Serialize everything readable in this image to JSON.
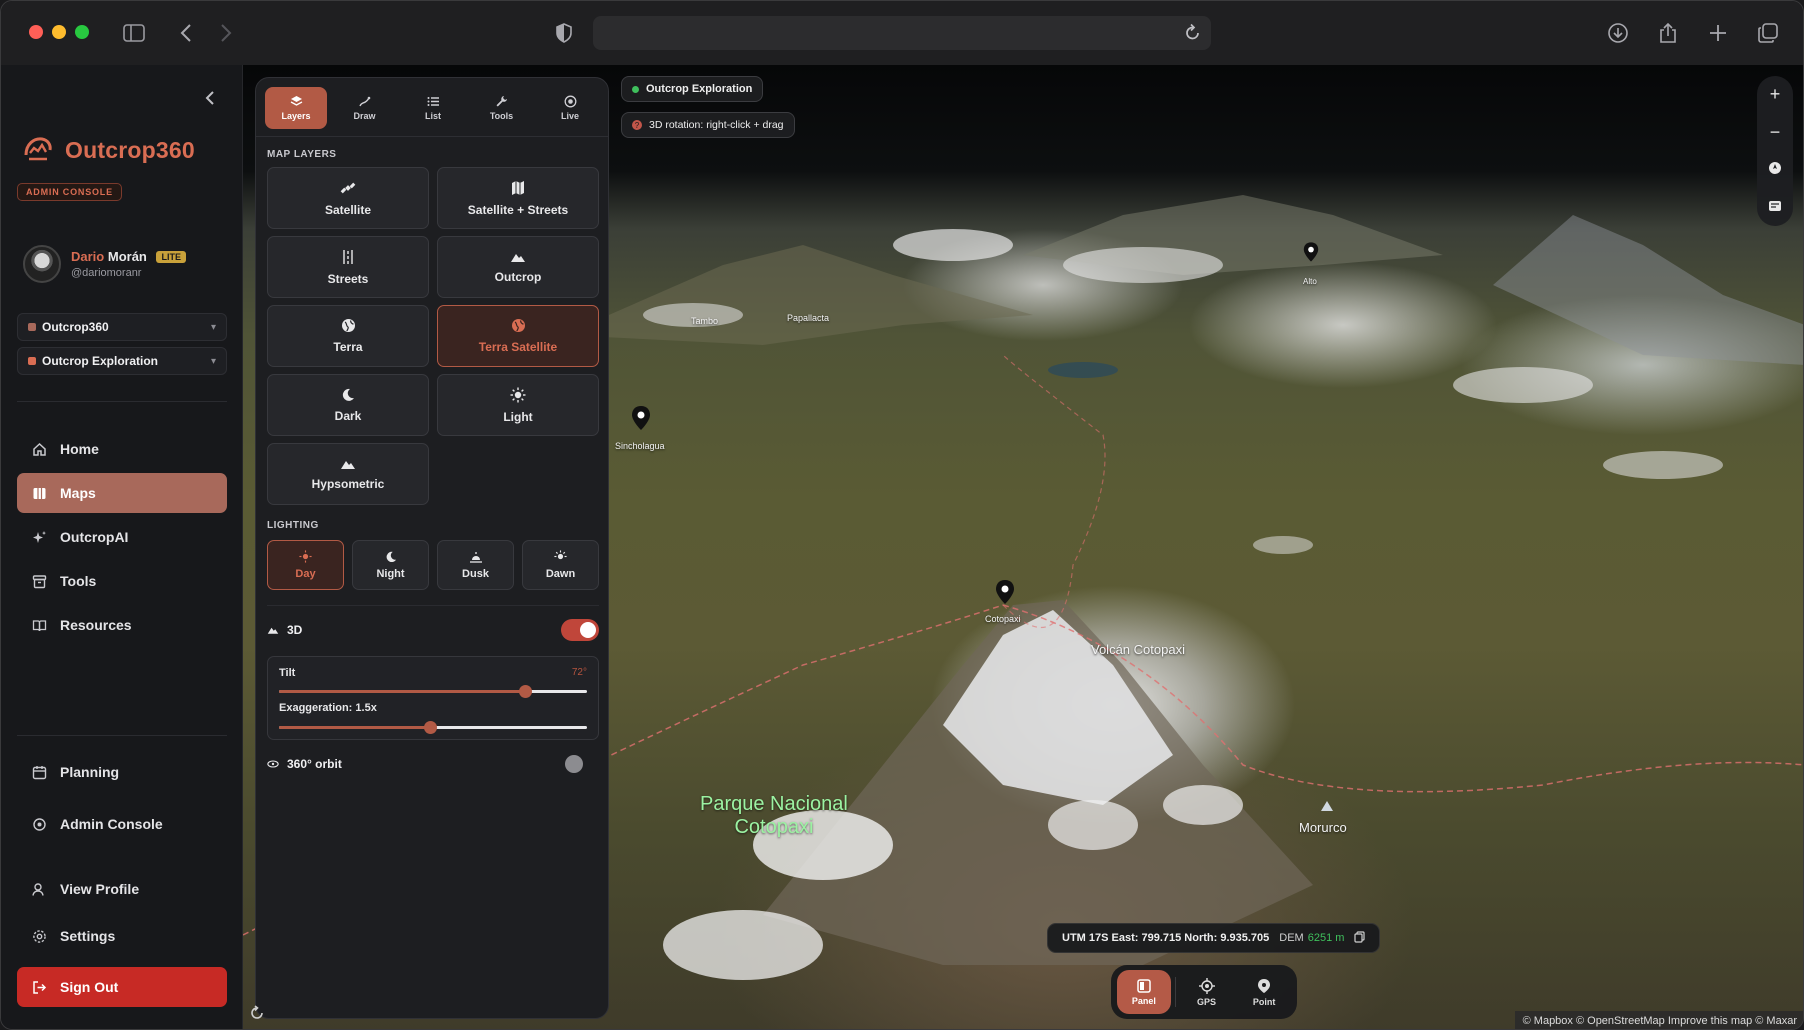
{
  "sidebar": {
    "brand": "Outcrop360",
    "admin_badge": "ADMIN CONSOLE",
    "user": {
      "first_name": "Dario",
      "last_name": "Morán",
      "plan": "LITE",
      "handle": "@dariomoranr"
    },
    "org_select": "Outcrop360",
    "project_select": "Outcrop Exploration",
    "nav": {
      "home": "Home",
      "maps": "Maps",
      "outcropai": "OutcropAI",
      "tools": "Tools",
      "resources": "Resources",
      "planning": "Planning",
      "admin_console": "Admin Console",
      "view_profile": "View Profile",
      "settings": "Settings",
      "sign_out": "Sign Out"
    }
  },
  "panel": {
    "tabs": {
      "layers": "Layers",
      "draw": "Draw",
      "list": "List",
      "tools": "Tools",
      "live": "Live"
    },
    "active_tab": "Layers",
    "map_layers_title": "MAP LAYERS",
    "layers": {
      "satellite": "Satellite",
      "satellite_streets": "Satellite + Streets",
      "streets": "Streets",
      "outcrop": "Outcrop",
      "terra": "Terra",
      "terra_satellite": "Terra Satellite",
      "dark": "Dark",
      "light": "Light",
      "hypsometric": "Hypsometric"
    },
    "active_layer": "Terra Satellite",
    "lighting_title": "LIGHTING",
    "lighting": {
      "day": "Day",
      "night": "Night",
      "dusk": "Dusk",
      "dawn": "Dawn"
    },
    "active_lighting": "Day",
    "three_d": {
      "label": "3D",
      "enabled": true
    },
    "tilt": {
      "label": "Tilt",
      "value_text": "72°",
      "fraction": 0.8
    },
    "exaggeration": {
      "label": "Exaggeration: 1.5x",
      "fraction": 0.49
    },
    "orbit": {
      "label": "360° orbit",
      "enabled": false
    }
  },
  "map": {
    "project_pill": "Outcrop Exploration",
    "hint_pill": "3D rotation: right-click + drag",
    "controls": {
      "zoom_in": "+",
      "zoom_out": "−"
    },
    "labels": {
      "volcan": "Volcán Cotopaxi",
      "park_line1": "Parque Nacional",
      "park_line2": "Cotopaxi",
      "morurco": "Morurco",
      "cotopaxi_pin": "Cotopaxi",
      "sincholagua_pin": "Sincholagua",
      "tambo": "Tambo",
      "papallacta": "Papallacta",
      "alto_pin": "Alto"
    },
    "coords": {
      "text": "UTM 17S East: 799.715 North: 9.935.705",
      "dem_label": "DEM",
      "dem_value": "6251 m"
    },
    "bottom_bar": {
      "panel": "Panel",
      "gps": "GPS",
      "point": "Point"
    },
    "attribution": "© Mapbox © OpenStreetMap  Improve this map © Maxar"
  },
  "colors": {
    "accent": "#b25a45",
    "brand": "#d96d53",
    "signout": "#c72a25",
    "toggle_on": "#c0463a"
  }
}
